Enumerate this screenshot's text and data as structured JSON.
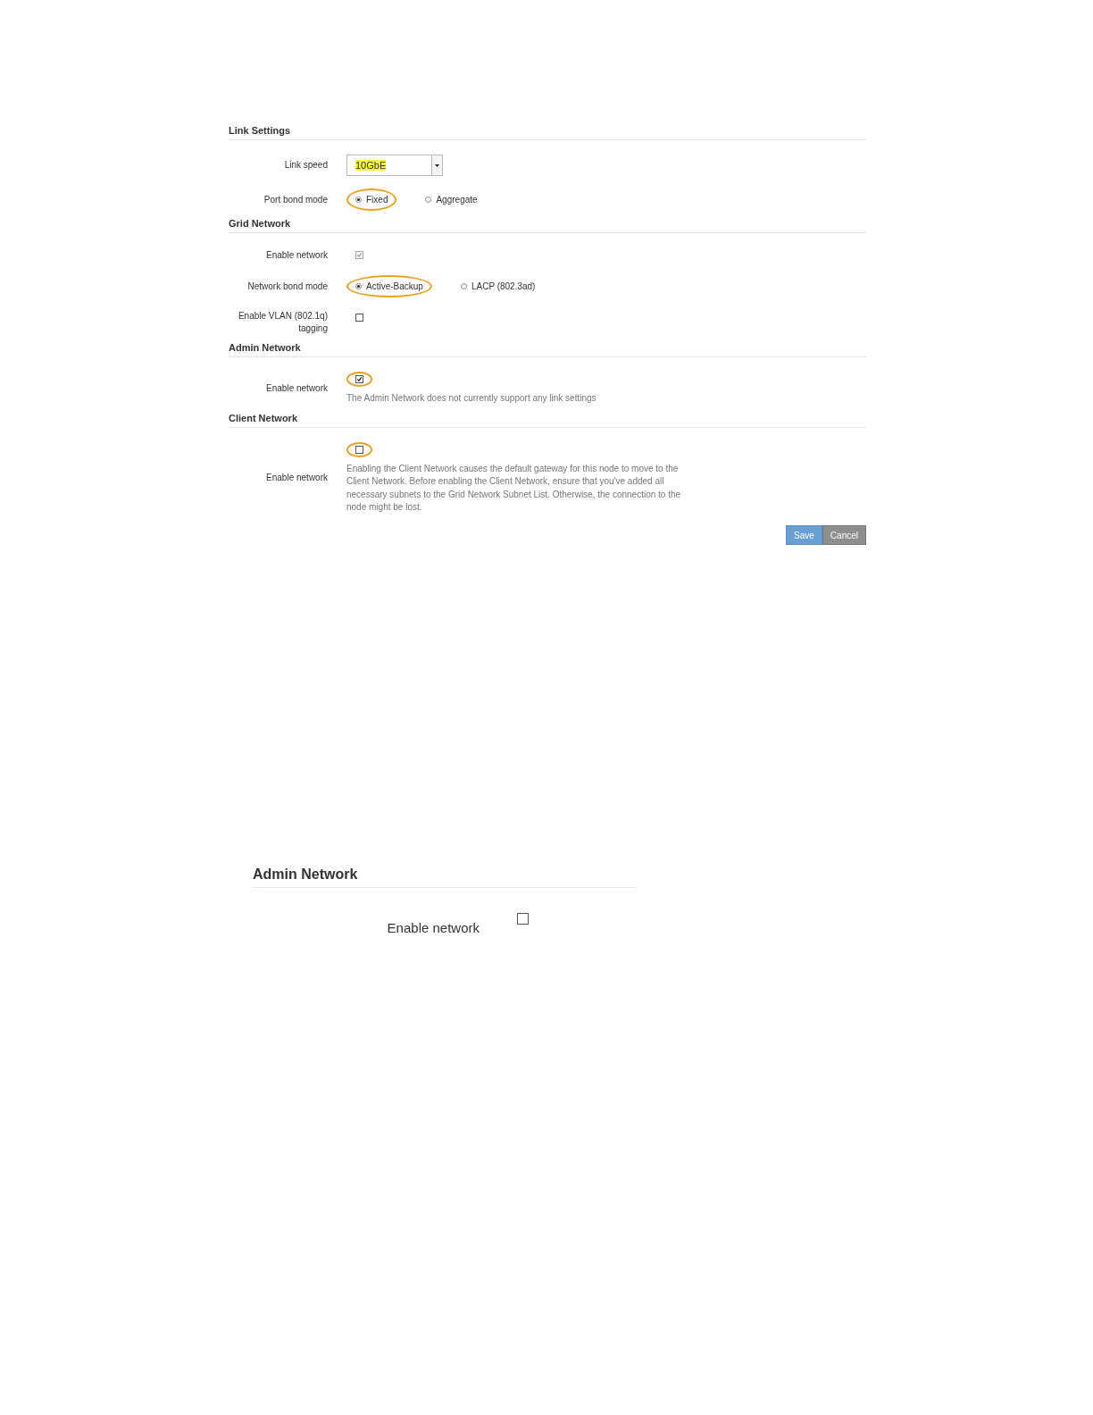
{
  "panels": [
    {
      "sections": [
        {
          "title": "Link Settings",
          "rows": [
            {
              "kind": "select",
              "label": "Link speed",
              "value": "10GbE",
              "marked": true
            },
            {
              "kind": "radio",
              "label": "Port bond mode",
              "options": [
                {
                  "label": "Fixed",
                  "selected": true,
                  "highlighted": true
                },
                {
                  "label": "Aggregate",
                  "selected": false,
                  "highlighted": false
                }
              ]
            }
          ]
        },
        {
          "title": "Grid Network",
          "rows": [
            {
              "kind": "checkbox",
              "label": "Enable network",
              "checked": true,
              "disabled": true,
              "highlighted": false
            },
            {
              "kind": "radio",
              "label": "Network bond mode",
              "options": [
                {
                  "label": "Active-Backup",
                  "selected": true,
                  "highlighted": true
                },
                {
                  "label": "LACP (802.3ad)",
                  "selected": false,
                  "highlighted": false
                }
              ]
            },
            {
              "kind": "checkbox",
              "label": "Enable VLAN (802.1q) tagging",
              "checked": false,
              "disabled": false,
              "highlighted": false
            }
          ]
        },
        {
          "title": "Admin Network",
          "rows": [
            {
              "kind": "checkbox",
              "label": "Enable network",
              "checked": true,
              "disabled": false,
              "highlighted": true,
              "note": "The Admin Network does not currently support any link settings"
            }
          ]
        },
        {
          "title": "Client Network",
          "rows": [
            {
              "kind": "checkbox",
              "label": "Enable network",
              "checked": false,
              "disabled": false,
              "highlighted": true,
              "note": "Enabling the Client Network causes the default gateway for this node to move to the Client Network. Before enabling the Client Network, ensure that you've added all necessary subnets to the Grid Network Subnet List. Otherwise, the connection to the node might be lost."
            }
          ]
        }
      ],
      "buttons": [
        {
          "label": "Save",
          "kind": "primary"
        },
        {
          "label": "Cancel",
          "kind": "secondary"
        }
      ]
    },
    {
      "sections": [
        {
          "title": "Admin Network",
          "rows": [
            {
              "kind": "checkbox",
              "label": "Enable network",
              "checked": false,
              "disabled": false,
              "highlighted": false
            }
          ]
        }
      ]
    }
  ]
}
